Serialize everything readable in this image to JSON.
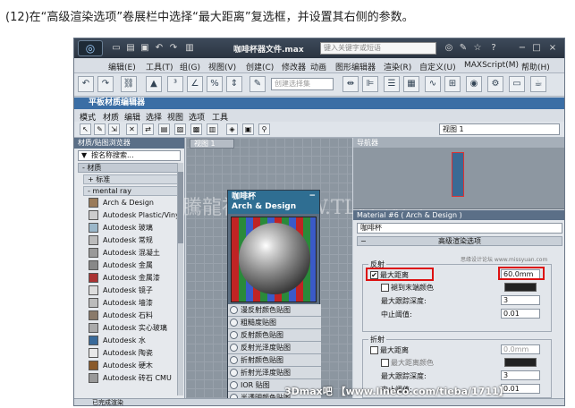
{
  "caption": "(12)在“高级渲染选项”卷展栏中选择“最大距离”复选框，并设置其右侧的参数。",
  "app": {
    "title": "咖啡杯器文件.max",
    "search_placeholder": "键入关键字或短语",
    "menu": [
      "编辑(E)",
      "工具(T)",
      "组(G)",
      "视图(V)",
      "创建(C)",
      "修改器",
      "动画",
      "图形编辑器",
      "渲染(R)",
      "自定义(U)",
      "MAXScript(M)",
      "帮助(H)"
    ],
    "selection_set_placeholder": "创建选择集"
  },
  "sme": {
    "title": "平板材质编辑器",
    "menu": [
      "模式",
      "材质",
      "编辑",
      "选择",
      "视图",
      "选项",
      "工具"
    ],
    "view_dropdown": "视图 1"
  },
  "browser": {
    "header": "材质/贴图浏览器",
    "search": "按名称搜索...",
    "group_materials": "- 材质",
    "sub_standard": "+ 标准",
    "sub_mentalray": "- mental ray",
    "items": [
      "Arch & Design",
      "Autodesk Plastic/Vinyl",
      "Autodesk 玻璃",
      "Autodesk 常规",
      "Autodesk 混凝土",
      "Autodesk 金属",
      "Autodesk 金属漆",
      "Autodesk 镜子",
      "Autodesk 墙漆",
      "Autodesk 石料",
      "Autodesk 实心玻璃",
      "Autodesk 水",
      "Autodesk 陶瓷",
      "Autodesk 硬木",
      "Autodesk 砖石 CMU"
    ]
  },
  "view": {
    "tab": "视图 1",
    "node_title": "咖啡杯",
    "node_type": "Arch & Design",
    "node_minimize": "−",
    "slots": [
      "漫反射颜色贴图",
      "粗糙度贴图",
      "反射颜色贴图",
      "反射光泽度贴图",
      "折射颜色贴图",
      "折射光泽度贴图",
      "IOR 贴图",
      "半透明颜色贴图"
    ],
    "watermark": "騰龍視覺 WWW.TLVI.NET"
  },
  "navigator": {
    "header": "导航器"
  },
  "props": {
    "header": "Material #6 ( Arch & Design )",
    "name": "咖啡杯",
    "rollout_toggle": "−",
    "rollout_title": "高级渲染选项",
    "reflection": {
      "label": "反射",
      "max_distance_label": "最大距离",
      "max_distance_checked": true,
      "max_distance_value": "60.0mm",
      "fade_label": "褪到末端颜色",
      "max_depth_label": "最大跟踪深度:",
      "max_depth_value": "3",
      "cutoff_label": "中止阈值:",
      "cutoff_value": "0.01"
    },
    "refraction": {
      "label": "折射",
      "max_distance_label": "最大距离",
      "max_distance_value": "0.0mm",
      "color_label": "最大距离颜色",
      "max_depth_label": "最大跟踪深度:",
      "max_depth_value": "3",
      "cutoff_label": "中止阈值:",
      "cutoff_value": "0.01"
    },
    "corner_watermark": "思缘设计论坛 www.missyuan.com"
  },
  "status": {
    "text": "已完成渲染"
  },
  "footer_watermark": "3Dmax吧 【www.lineco.com/tieba/1711】"
}
